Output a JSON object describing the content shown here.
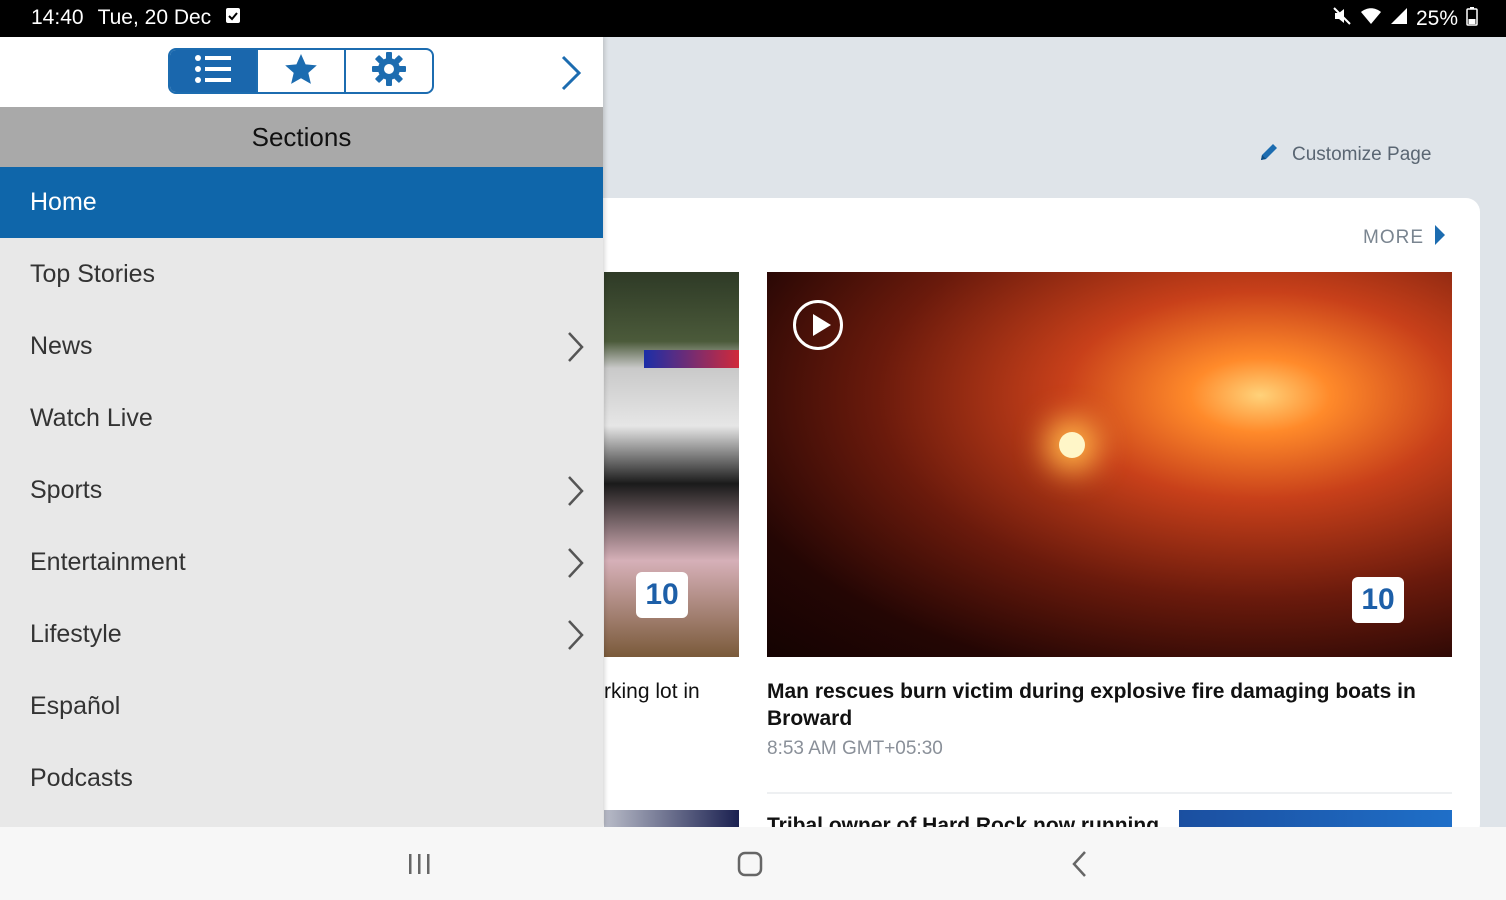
{
  "status_bar": {
    "time": "14:40",
    "date": "Tue, 20 Dec",
    "battery": "25%",
    "icons": [
      "calendar-icon",
      "mute-icon",
      "wifi-icon",
      "signal-icon",
      "battery-icon"
    ]
  },
  "drawer": {
    "tabs": [
      {
        "icon": "list-icon",
        "active": true
      },
      {
        "icon": "star-icon",
        "active": false
      },
      {
        "icon": "gear-icon",
        "active": false
      }
    ],
    "header": "Sections",
    "items": [
      {
        "label": "Home",
        "active": true,
        "has_submenu": false
      },
      {
        "label": "Top Stories",
        "active": false,
        "has_submenu": false
      },
      {
        "label": "News",
        "active": false,
        "has_submenu": true
      },
      {
        "label": "Watch Live",
        "active": false,
        "has_submenu": false
      },
      {
        "label": "Sports",
        "active": false,
        "has_submenu": true
      },
      {
        "label": "Entertainment",
        "active": false,
        "has_submenu": true
      },
      {
        "label": "Lifestyle",
        "active": false,
        "has_submenu": true
      },
      {
        "label": "Español",
        "active": false,
        "has_submenu": false
      },
      {
        "label": "Podcasts",
        "active": false,
        "has_submenu": false
      }
    ]
  },
  "main": {
    "customize_label": "Customize Page",
    "more_label": "MORE",
    "left_story_fragment": "rking lot in",
    "featured_story": {
      "title": "Man rescues burn victim during explosive fire damaging boats in Broward",
      "time": "8:53 AM GMT+05:30"
    },
    "logo_text": "10",
    "next_story_fragment": "Tribal owner of Hard Rock now running"
  },
  "colors": {
    "accent": "#0f66aa",
    "header_gray": "#a9a9a9",
    "drawer_bg": "#e8e8e8",
    "page_bg": "#dfe4e9"
  }
}
